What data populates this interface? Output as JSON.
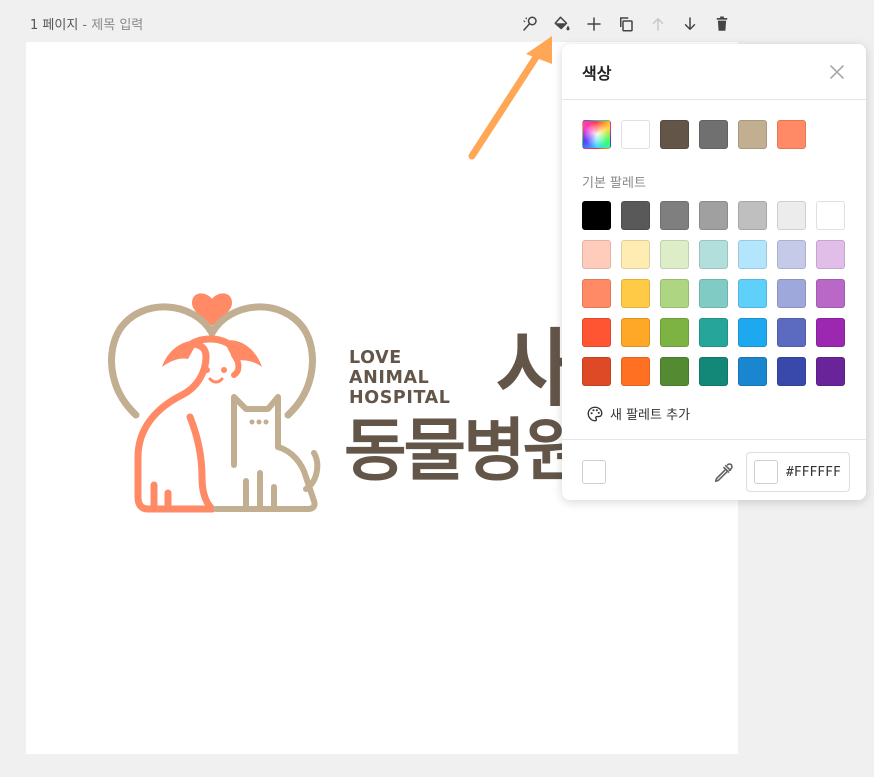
{
  "header": {
    "page_label": "1 페이지",
    "separator": " - ",
    "title_placeholder": "제목 입력"
  },
  "toolbar": {
    "icons": [
      "magic-wand-icon",
      "paint-bucket-icon",
      "plus-icon",
      "duplicate-icon",
      "arrow-up-icon",
      "arrow-down-icon",
      "trash-icon"
    ]
  },
  "logo": {
    "en_line1": "LOVE",
    "en_line2": "ANIMAL",
    "en_line3": "HOSPITAL",
    "ko_line1": "사",
    "ko_line2": "동물병원",
    "colors": {
      "brown": "#635649",
      "tan": "#c2ae91",
      "coral": "#ff8a65"
    }
  },
  "color_panel": {
    "title": "색상",
    "recent_colors": [
      "#FFFFFF",
      "#635649",
      "#707070",
      "#C2AE91",
      "#FF8A65"
    ],
    "palette_label": "기본 팔레트",
    "palette": [
      [
        "#000000",
        "#595959",
        "#7F7F7F",
        "#A0A0A0",
        "#BFBFBF",
        "#ECECEC",
        "#FFFFFF"
      ],
      [
        "#FFCCBC",
        "#FFECB3",
        "#DCEDC8",
        "#B2DFDB",
        "#B3E5FC",
        "#C5CAE9",
        "#E1BEE7"
      ],
      [
        "#FF8A65",
        "#FFCA45",
        "#AED581",
        "#80CBC4",
        "#5FD0FA",
        "#9FA8DA",
        "#BA68C8"
      ],
      [
        "#FF5532",
        "#FFA726",
        "#7CB342",
        "#26A69A",
        "#1EA8F0",
        "#5C6BC0",
        "#9C27B0"
      ],
      [
        "#DD4A25",
        "#FF7023",
        "#548B32",
        "#138879",
        "#1A86D0",
        "#3949AB",
        "#6A2499"
      ]
    ],
    "add_palette_label": "새 팔레트 추가",
    "current_color": "#FFFFFF",
    "hex_value": "#FFFFFF"
  },
  "accent_arrow_color": "#FFA755"
}
